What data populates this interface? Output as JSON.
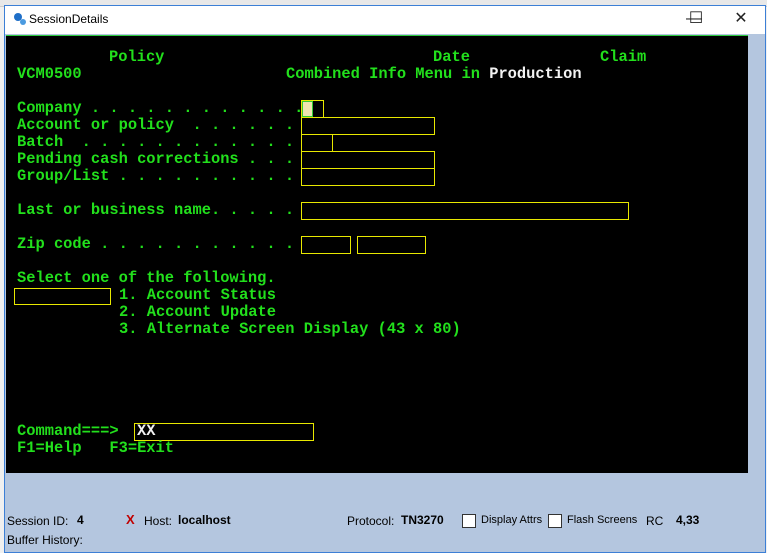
{
  "window": {
    "title": "SessionDetails",
    "minimize": "—",
    "maximize": "☐",
    "close": "✕"
  },
  "screen": {
    "header": {
      "policy": "Policy",
      "date": "Date",
      "claim": "Claim",
      "screen_id": "VCM0500",
      "title": "Combined Info Menu in ",
      "environment": "Production"
    },
    "fields": [
      {
        "label": "Company . . . . . . . . . . . .",
        "value": ""
      },
      {
        "label": "Account or policy  . . . . . .",
        "value": ""
      },
      {
        "label": "Batch  . . . . . . . . . . . .",
        "value": ""
      },
      {
        "label": "Pending cash corrections . . .",
        "value": ""
      },
      {
        "label": "Group/List . . . . . . . . . .",
        "value": ""
      },
      {
        "label": "Last or business name. . . . .",
        "value": ""
      },
      {
        "label": "Zip code . . . . . . . . . . .",
        "value": ""
      }
    ],
    "select_prompt": "Select one of the following.",
    "options": [
      "1. Account Status",
      "2. Account Update",
      "3. Alternate Screen Display (43 x 80)"
    ],
    "command_label": "Command===>",
    "command_value": "XX",
    "fkeys": "F1=Help   F3=Exit"
  },
  "status": {
    "session_label": "Session ID:",
    "session_id": "4",
    "host_status_icon": "x-icon",
    "host_label": "Host:",
    "host": "localhost",
    "protocol_label": "Protocol:",
    "protocol": "TN3270",
    "display_attrs": "Display Attrs",
    "display_attrs_checked": false,
    "flash_screens": "Flash Screens",
    "flash_screens_checked": false,
    "rc_label": "RC",
    "rc": "4,33",
    "buffer_history": "Buffer History:"
  },
  "colors": {
    "terminal_text": "#22e01c",
    "field_border": "#e8e800",
    "terminal_bg": "#000000",
    "panel_bg": "#b4c6df"
  }
}
